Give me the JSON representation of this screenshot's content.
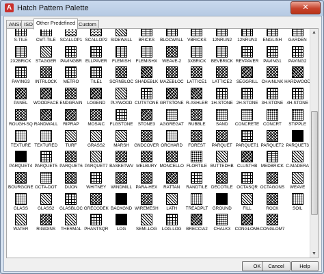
{
  "window": {
    "title": "Hatch Pattern Palette",
    "app_icon_glyph": "A",
    "close_glyph": "✕"
  },
  "tabs": [
    {
      "label": "ANSI",
      "active": false
    },
    {
      "label": "ISO",
      "active": false
    },
    {
      "label": "Other Predefined",
      "active": true
    },
    {
      "label": "Custom",
      "active": false
    }
  ],
  "patterns": [
    {
      "name": "S-TILE",
      "style": "grid"
    },
    {
      "name": "CMT-TILE",
      "style": "grid"
    },
    {
      "name": "SCALLOP1",
      "style": "wave"
    },
    {
      "name": "SCALLOP2",
      "style": "wave"
    },
    {
      "name": "SIDEWALL",
      "style": "hatch"
    },
    {
      "name": "BRICKS",
      "style": "brick"
    },
    {
      "name": "BLOCWALL",
      "style": "brick"
    },
    {
      "name": "VBRICKS",
      "style": "brick"
    },
    {
      "name": "12NRUN2",
      "style": "brick"
    },
    {
      "name": "12NRUN3",
      "style": "brick"
    },
    {
      "name": "ENGLISH",
      "style": "brick"
    },
    {
      "name": "GARDEN",
      "style": "brick"
    },
    {
      "name": "2X2BRICK",
      "style": "brick"
    },
    {
      "name": "STAGGER",
      "style": "hatch"
    },
    {
      "name": "PAVINGBR",
      "style": "grid"
    },
    {
      "name": "ELLPAVER",
      "style": "grid"
    },
    {
      "name": "FLEMISH",
      "style": "brick"
    },
    {
      "name": "FLEMISHX",
      "style": "brick"
    },
    {
      "name": "WEAVE-2",
      "style": "cross"
    },
    {
      "name": "3XBRICK",
      "style": "brick"
    },
    {
      "name": "BEVBRICK",
      "style": "brick"
    },
    {
      "name": "REVPAVER",
      "style": "grid"
    },
    {
      "name": "PAVING1",
      "style": "grid"
    },
    {
      "name": "PAVING2",
      "style": "grid"
    },
    {
      "name": "PAVING3",
      "style": "grid"
    },
    {
      "name": "INTRLOCK",
      "style": "cross"
    },
    {
      "name": "METRO",
      "style": "grid"
    },
    {
      "name": "TILE1",
      "style": "grid"
    },
    {
      "name": "SCRNBLOC",
      "style": "cross"
    },
    {
      "name": "SHADEBLK",
      "style": "dark"
    },
    {
      "name": "MAZEBLOC",
      "style": "cross"
    },
    {
      "name": "LATTICE1",
      "style": "cross"
    },
    {
      "name": "LATTICE2",
      "style": "cross"
    },
    {
      "name": "SEGGRILL",
      "style": "dark"
    },
    {
      "name": "CHAINLNK",
      "style": "cross"
    },
    {
      "name": "HARDWOOD",
      "style": "dark"
    },
    {
      "name": "PANEL",
      "style": "dark"
    },
    {
      "name": "WOODFACE",
      "style": "dark"
    },
    {
      "name": "ENDGRAIN",
      "style": "cross"
    },
    {
      "name": "LOGEND",
      "style": "dark"
    },
    {
      "name": "PLYWOOD",
      "style": "hatch"
    },
    {
      "name": "CUTSTONE",
      "style": "grid"
    },
    {
      "name": "GRTSTONE",
      "style": "dark"
    },
    {
      "name": "R-ASHLER",
      "style": "dark"
    },
    {
      "name": "1H-STONE",
      "style": "grid"
    },
    {
      "name": "2H-STONE",
      "style": "grid"
    },
    {
      "name": "3H-STONE",
      "style": "grid"
    },
    {
      "name": "4H-STONE",
      "style": "grid"
    },
    {
      "name": "ROUGH-SQ",
      "style": "cross"
    },
    {
      "name": "RANDWALL",
      "style": "dark"
    },
    {
      "name": "RIPRAP",
      "style": "dark"
    },
    {
      "name": "MOSAIC",
      "style": "cross"
    },
    {
      "name": "FLGSTONE",
      "style": "grid"
    },
    {
      "name": "STONE3",
      "style": "dark"
    },
    {
      "name": "AGGREGAT",
      "style": "dots"
    },
    {
      "name": "RUBBLE",
      "style": "cross"
    },
    {
      "name": "SAND",
      "style": "dots"
    },
    {
      "name": "CONCRETE",
      "style": "dots"
    },
    {
      "name": "CONCRT",
      "style": "dots"
    },
    {
      "name": "STIPPLE",
      "style": "dots"
    },
    {
      "name": "TEXTURE",
      "style": "dots"
    },
    {
      "name": "TEXTURED",
      "style": "dots"
    },
    {
      "name": "TURF",
      "style": "hatch"
    },
    {
      "name": "GRASS2",
      "style": "hatch"
    },
    {
      "name": "MARSH",
      "style": "hatch"
    },
    {
      "name": "GNDCOVER",
      "style": "cross"
    },
    {
      "name": "ORCHARD",
      "style": "dots"
    },
    {
      "name": "FOREST",
      "style": "cross"
    },
    {
      "name": "PARQUET",
      "style": "cross"
    },
    {
      "name": "PARQUET1",
      "style": "grid"
    },
    {
      "name": "PARQUET2",
      "style": "cross"
    },
    {
      "name": "PARQUET3",
      "style": "solid"
    },
    {
      "name": "PARQUET4",
      "style": "solid"
    },
    {
      "name": "PARQUET5",
      "style": "grid"
    },
    {
      "name": "PARQUET6",
      "style": "cross"
    },
    {
      "name": "PARQUET7",
      "style": "hatch"
    },
    {
      "name": "BASKETWV",
      "style": "cross"
    },
    {
      "name": "MELBURY",
      "style": "cross"
    },
    {
      "name": "MONCELLO",
      "style": "cross"
    },
    {
      "name": "FLORTILE",
      "style": "dots"
    },
    {
      "name": "BUTTEDHB",
      "style": "hatch"
    },
    {
      "name": "CLUSTHB",
      "style": "dark"
    },
    {
      "name": "MEDBRICK",
      "style": "brick"
    },
    {
      "name": "C-MADERA",
      "style": "hatch"
    },
    {
      "name": "BOURGONE",
      "style": "cross"
    },
    {
      "name": "OCTA-DOT",
      "style": "dots"
    },
    {
      "name": "DIJON",
      "style": "cross"
    },
    {
      "name": "WHITNEY",
      "style": "grid"
    },
    {
      "name": "WINDMILL",
      "style": "cross"
    },
    {
      "name": "PARA-HEX",
      "style": "cross"
    },
    {
      "name": "RATTAN",
      "style": "dark"
    },
    {
      "name": "RANDTILE",
      "style": "grid"
    },
    {
      "name": "DECOTILE",
      "style": "cross"
    },
    {
      "name": "OCTASQR",
      "style": "grid"
    },
    {
      "name": "OCTAGONS",
      "style": "cross"
    },
    {
      "name": "WEAVE",
      "style": "hatch"
    },
    {
      "name": "GLASS",
      "style": "dots"
    },
    {
      "name": "GLASS2",
      "style": "hatch"
    },
    {
      "name": "GLASBLOC",
      "style": "grid"
    },
    {
      "name": "GRECODEK",
      "style": "cross"
    },
    {
      "name": "BACKGND",
      "style": "solid"
    },
    {
      "name": "WIREMESH",
      "style": "cross"
    },
    {
      "name": "LATH",
      "style": "hatch"
    },
    {
      "name": "TREADPLT",
      "style": "dots"
    },
    {
      "name": "GROUND",
      "style": "solid"
    },
    {
      "name": "FILL",
      "style": "hatch"
    },
    {
      "name": "ROCK",
      "style": "cross"
    },
    {
      "name": "SOIL",
      "style": "dots"
    },
    {
      "name": "WATER",
      "style": "hatch"
    },
    {
      "name": "RIGIDINS",
      "style": "cross"
    },
    {
      "name": "THERMAL",
      "style": "hatch"
    },
    {
      "name": "PHANTSQR",
      "style": "grid"
    },
    {
      "name": "LOG",
      "style": "solid"
    },
    {
      "name": "SEMI-LOG",
      "style": "hatch"
    },
    {
      "name": "LOG-LOG",
      "style": "grid"
    },
    {
      "name": "BRECCIA2",
      "style": "dark"
    },
    {
      "name": "CHALK3",
      "style": "dots"
    },
    {
      "name": "CONGLOM6",
      "style": "dark"
    },
    {
      "name": "CONGLOM7",
      "style": "cross"
    }
  ],
  "scrollbar": {
    "up_glyph": "▲",
    "down_glyph": "▼"
  },
  "buttons": {
    "ok": "OK",
    "cancel": "Cancel",
    "help": "Help"
  }
}
